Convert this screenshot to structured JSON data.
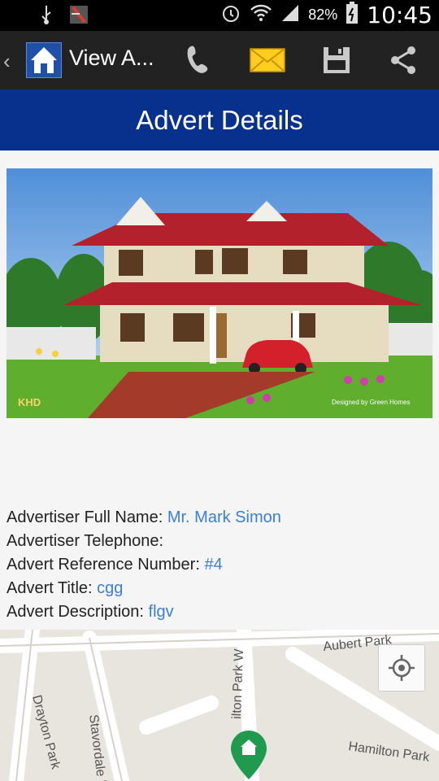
{
  "status_bar": {
    "battery": "82%",
    "time": "10:45"
  },
  "action_bar": {
    "back": "‹",
    "title": "View A..."
  },
  "header": {
    "title": "Advert Details"
  },
  "photo": {
    "watermark_left": "KHD",
    "caption_right": "Designed by Green Homes"
  },
  "details": {
    "full_name_label": "Advertiser Full Name:",
    "full_name_value": "Mr. Mark Simon",
    "telephone_label": "Advertiser Telephone:",
    "telephone_value": "",
    "reference_label": "Advert Reference Number:",
    "reference_value": "#4",
    "title_label": "Advert Title:",
    "title_value": "cgg",
    "description_label": "Advert Description:",
    "description_value": "flgv"
  },
  "map": {
    "streets": [
      "Aubert Park",
      "Drayton Park",
      "Stavordale R",
      "ilton Park W",
      "Hamilton Park"
    ]
  }
}
